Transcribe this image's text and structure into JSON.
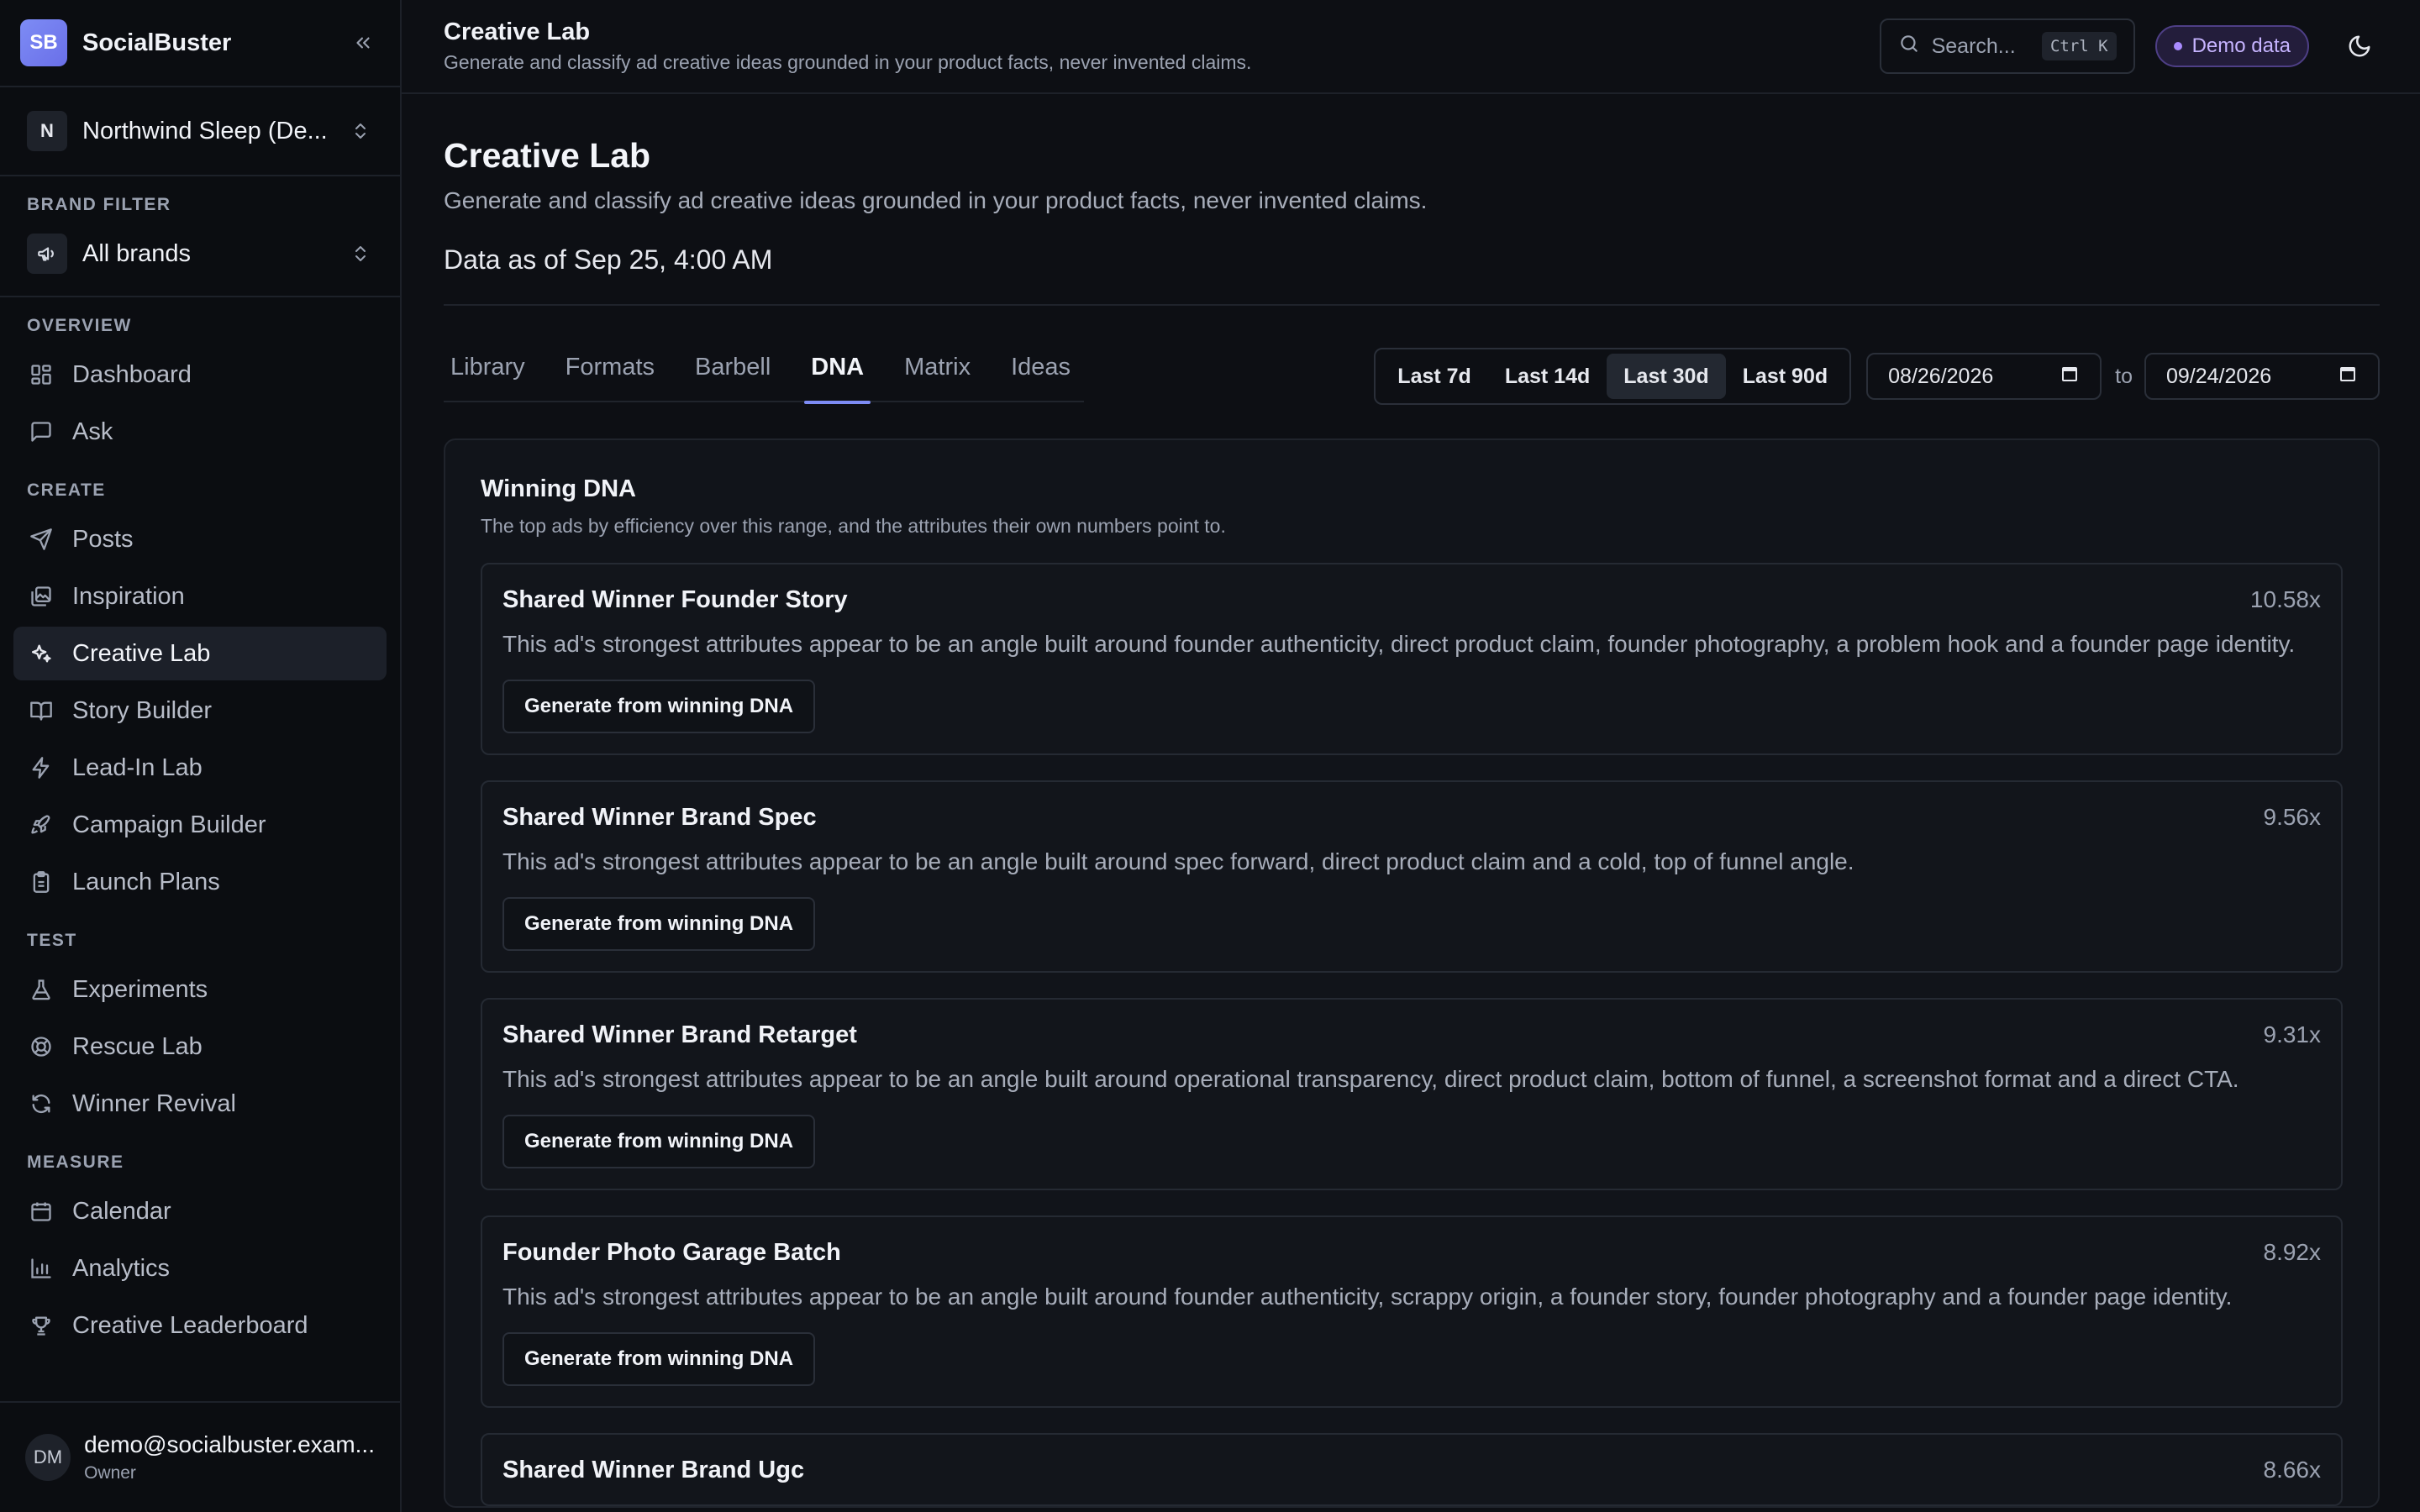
{
  "app": {
    "logo": "SB",
    "name": "SocialBuster"
  },
  "workspace": {
    "initial": "N",
    "name": "Northwind Sleep (De..."
  },
  "brand_filter": {
    "label": "BRAND FILTER",
    "value": "All brands"
  },
  "nav": {
    "overview": {
      "label": "OVERVIEW",
      "items": [
        "Dashboard",
        "Ask"
      ]
    },
    "create": {
      "label": "CREATE",
      "items": [
        "Posts",
        "Inspiration",
        "Creative Lab",
        "Story Builder",
        "Lead-In Lab",
        "Campaign Builder",
        "Launch Plans"
      ],
      "active": "Creative Lab"
    },
    "test": {
      "label": "TEST",
      "items": [
        "Experiments",
        "Rescue Lab",
        "Winner Revival"
      ]
    },
    "measure": {
      "label": "MEASURE",
      "items": [
        "Calendar",
        "Analytics",
        "Creative Leaderboard"
      ]
    }
  },
  "user": {
    "initials": "DM",
    "email": "demo@socialbuster.exam...",
    "role": "Owner"
  },
  "topbar": {
    "title": "Creative Lab",
    "subtitle": "Generate and classify ad creative ideas grounded in your product facts, never invented claims.",
    "search_placeholder": "Search...",
    "search_shortcut": "Ctrl K",
    "demo_badge": "Demo data"
  },
  "page": {
    "title": "Creative Lab",
    "subtitle": "Generate and classify ad creative ideas grounded in your product facts, never invented claims.",
    "data_as_of": "Data as of Sep 25, 4:00 AM"
  },
  "tabs": [
    "Library",
    "Formats",
    "Barbell",
    "DNA",
    "Matrix",
    "Ideas"
  ],
  "active_tab": "DNA",
  "ranges": [
    "Last 7d",
    "Last 14d",
    "Last 30d",
    "Last 90d"
  ],
  "active_range": "Last 30d",
  "date_from": "08/26/2026",
  "date_to": "09/24/2026",
  "to_label": "to",
  "panel": {
    "title": "Winning DNA",
    "subtitle": "The top ads by efficiency over this range, and the attributes their own numbers point to.",
    "button_label": "Generate from winning DNA",
    "cards": [
      {
        "title": "Shared Winner Founder Story",
        "score": "10.58x",
        "desc": "This ad's strongest attributes appear to be an angle built around founder authenticity, direct product claim, founder photography, a problem hook and a founder page identity."
      },
      {
        "title": "Shared Winner Brand Spec",
        "score": "9.56x",
        "desc": "This ad's strongest attributes appear to be an angle built around spec forward, direct product claim and a cold, top of funnel angle."
      },
      {
        "title": "Shared Winner Brand Retarget",
        "score": "9.31x",
        "desc": "This ad's strongest attributes appear to be an angle built around operational transparency, direct product claim, bottom of funnel, a screenshot format and a direct CTA."
      },
      {
        "title": "Founder Photo Garage Batch",
        "score": "8.92x",
        "desc": "This ad's strongest attributes appear to be an angle built around founder authenticity, scrappy origin, a founder story, founder photography and a founder page identity."
      },
      {
        "title": "Shared Winner Brand Ugc",
        "score": "8.66x",
        "desc": ""
      }
    ]
  }
}
